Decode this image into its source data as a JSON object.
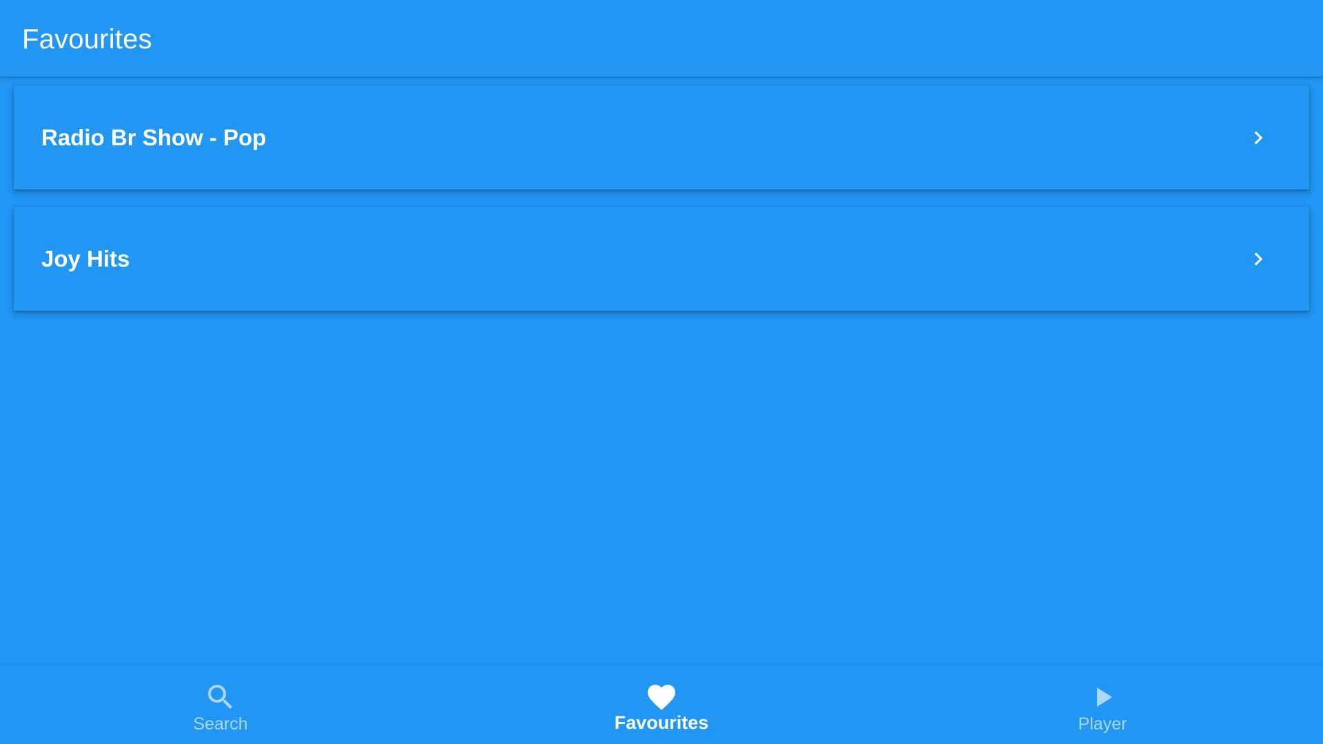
{
  "app_bar": {
    "title": "Favourites"
  },
  "favourites": [
    {
      "label": "Radio Br Show - Pop",
      "icon": "chevron-right-icon"
    },
    {
      "label": "Joy Hits",
      "icon": "chevron-right-icon"
    }
  ],
  "bottom_nav": {
    "items": [
      {
        "label": "Search",
        "icon": "search-icon",
        "active": false
      },
      {
        "label": "Favourites",
        "icon": "heart-icon",
        "active": true
      },
      {
        "label": "Player",
        "icon": "play-icon",
        "active": false
      }
    ]
  },
  "colors": {
    "primary": "#2196F3",
    "on_primary": "#FFFFFF"
  }
}
